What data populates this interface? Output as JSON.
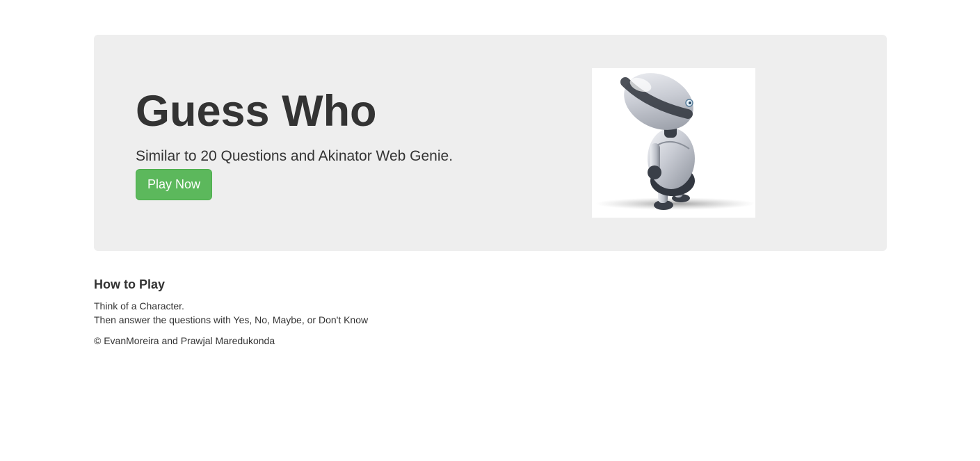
{
  "hero": {
    "title": "Guess Who",
    "subtitle": "Similar to 20 Questions and Akinator Web Genie.",
    "play_button_label": "Play Now",
    "image_alt": "robot-illustration"
  },
  "how_to_play": {
    "heading": "How to Play",
    "lines": [
      "Think of a Character.",
      "Then answer the questions with Yes, No, Maybe, or Don't Know"
    ]
  },
  "footer": {
    "credit": "© EvanMoreira and Prawjal Maredukonda"
  },
  "colors": {
    "jumbotron_bg": "#eeeeee",
    "button_green": "#5cb85c",
    "text": "#333333"
  }
}
